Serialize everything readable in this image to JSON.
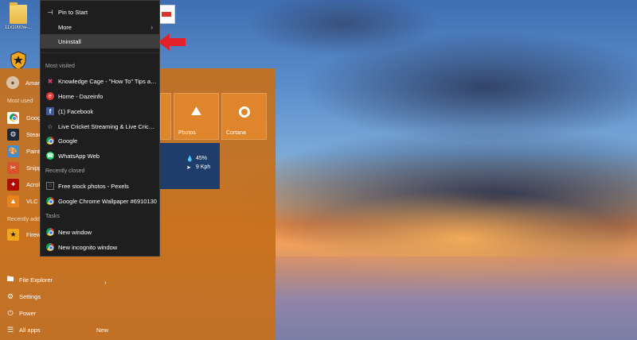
{
  "desktop": {
    "icons": [
      {
        "label": "11x1000w-..."
      },
      {
        "label": ""
      },
      {
        "label": ""
      }
    ]
  },
  "jump_list": {
    "top_items": [
      {
        "label": "Pin to Start",
        "icon": "pin-icon"
      },
      {
        "label": "More",
        "icon": "",
        "has_submenu": true
      },
      {
        "label": "Uninstall",
        "icon": "",
        "highlighted": true
      }
    ],
    "sections": {
      "most_visited": "Most visited",
      "recently_closed": "Recently closed",
      "tasks": "Tasks"
    },
    "most_visited": [
      {
        "label": "Knowledge Cage - \"How To\" Tips and T...",
        "icon": "knowledge-cage-icon"
      },
      {
        "label": "Home - Dazeinfo",
        "icon": "dazeinfo-icon"
      },
      {
        "label": "(1) Facebook",
        "icon": "facebook-icon"
      },
      {
        "label": "Live Cricket Streaming & Live Cricket S...",
        "icon": "star-icon"
      },
      {
        "label": "Google",
        "icon": "chrome-icon"
      },
      {
        "label": "WhatsApp Web",
        "icon": "whatsapp-icon"
      }
    ],
    "recently_closed": [
      {
        "label": "Free stock photos - Pexels",
        "icon": "pexels-icon"
      },
      {
        "label": "Google Chrome Wallpaper #6910130",
        "icon": "chrome-icon"
      }
    ],
    "tasks": [
      {
        "label": "New window",
        "icon": "chrome-icon"
      },
      {
        "label": "New incognito window",
        "icon": "chrome-icon"
      }
    ]
  },
  "start_menu": {
    "user_name": "Amar",
    "most_used_label": "Most used",
    "most_used": [
      {
        "label": "Goog",
        "icon": "chrome-icon"
      },
      {
        "label": "Stear",
        "icon": "steam-icon"
      },
      {
        "label": "Paint",
        "icon": "paint-icon"
      },
      {
        "label": "Snipp",
        "icon": "snipping-tool-icon"
      },
      {
        "label": "Acrol",
        "icon": "acrobat-icon"
      },
      {
        "label": "VLC r",
        "icon": "vlc-icon"
      }
    ],
    "recently_added_label": "Recently add",
    "recently_added": [
      {
        "label": "Firew",
        "icon": "firewall-icon"
      }
    ],
    "bottom": {
      "file_explorer": "File Explorer",
      "settings": "Settings",
      "power": "Power",
      "all_apps": "All apps",
      "new_badge": "New"
    },
    "tiles": {
      "photos": "Photos",
      "cortana": "Cortana",
      "weather_humidity": "45%",
      "weather_wind": "9 Kph"
    }
  },
  "colors": {
    "start_menu_bg": "#c6701c",
    "tile_bg": "#e0862c",
    "jump_list_bg": "#1e1e1e",
    "highlight": "#3d3d3d",
    "arrow": "#e4202a"
  }
}
